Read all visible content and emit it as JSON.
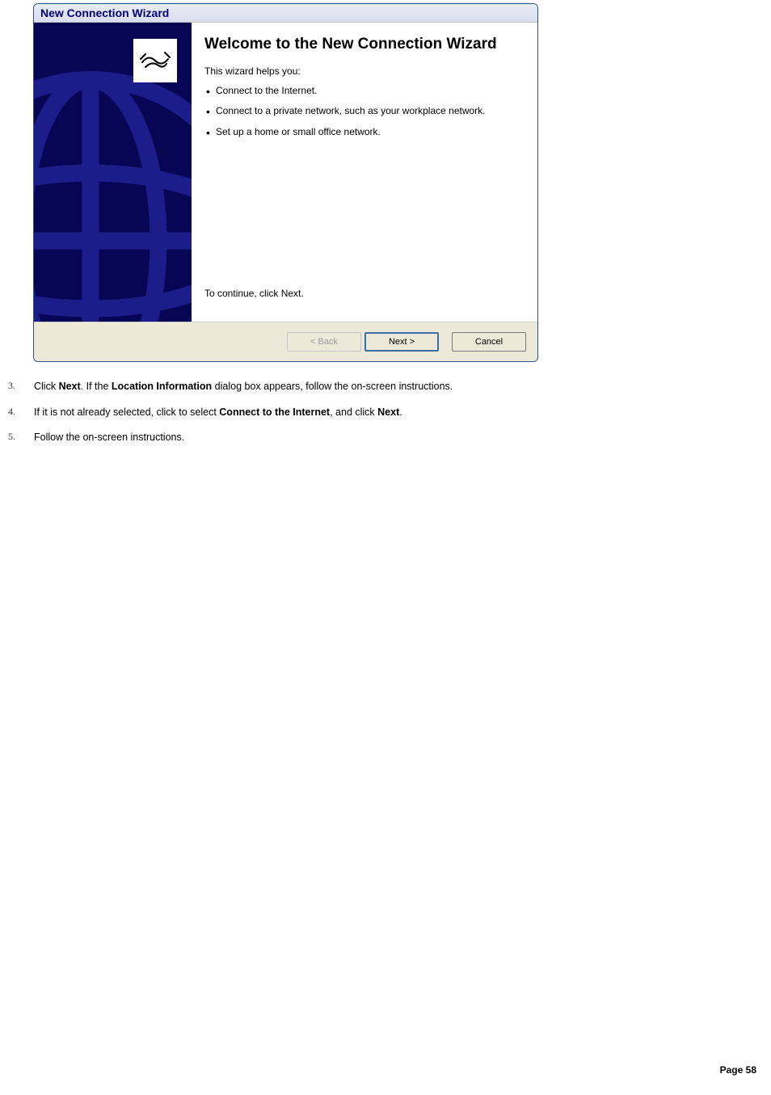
{
  "wizard": {
    "title": "New Connection Wizard",
    "heading": "Welcome to the New Connection Wizard",
    "intro": "This wizard helps you:",
    "bullets": [
      "Connect to the Internet.",
      "Connect to a private network, such as your workplace network.",
      "Set up a home or small office network."
    ],
    "continue": "To continue, click Next.",
    "buttons": {
      "back": "< Back",
      "next": "Next >",
      "cancel": "Cancel"
    }
  },
  "steps": {
    "s3_num": "3.",
    "s3_a": "Click ",
    "s3_b": "Next",
    "s3_c": ". If the ",
    "s3_d": "Location Information",
    "s3_e": " dialog box appears, follow the on-screen instructions.",
    "s4_num": "4.",
    "s4_a": "If it is not already selected, click to select ",
    "s4_b": "Connect to the Internet",
    "s4_c": ", and click ",
    "s4_d": "Next",
    "s4_e": ".",
    "s5_num": "5.",
    "s5_a": "Follow the on-screen instructions."
  },
  "page_label": "Page 58"
}
